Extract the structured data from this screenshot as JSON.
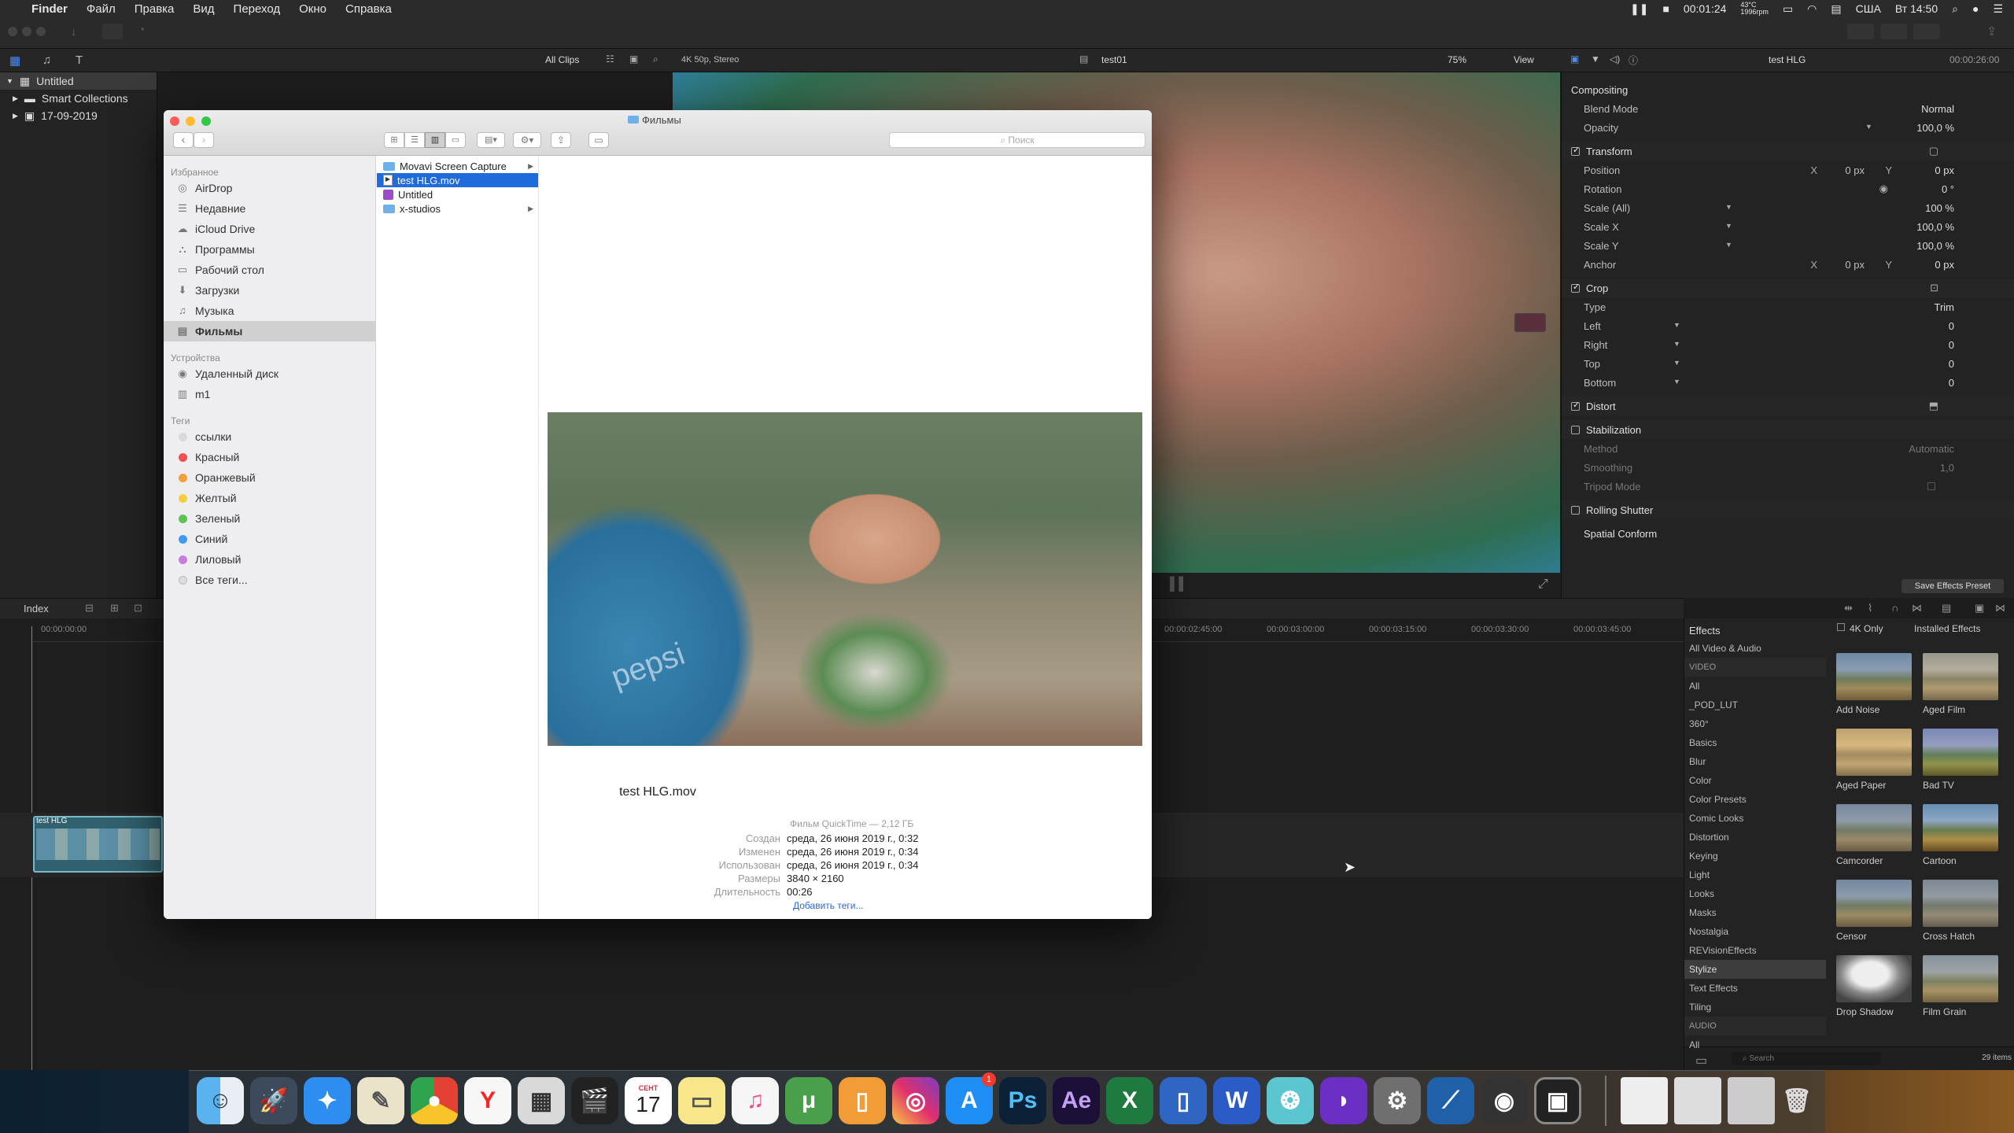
{
  "menubar": {
    "app": "Finder",
    "items": [
      "Файл",
      "Правка",
      "Вид",
      "Переход",
      "Окно",
      "Справка"
    ],
    "timer": "00:01:24",
    "temp": "43°C",
    "rpm": "1996rpm",
    "input_lang": "США",
    "clock": "Вт 14:50"
  },
  "fcp": {
    "library_name": "Untitled",
    "library_items": [
      "Smart Collections",
      "17-09-2019"
    ],
    "browser_filter": "All Clips",
    "format": "4K 50p, Stereo",
    "viewer_title": "test01",
    "zoom": "75%",
    "view_label": "View",
    "inspector_title": "test HLG",
    "inspector_time": "00:00:26:00",
    "index_label": "Index",
    "ruler_ticks": [
      "00:00:00:00",
      "00:00:02:45:00",
      "00:00:03:00:00",
      "00:00:03:15:00",
      "00:00:03:30:00",
      "00:00:03:45:00"
    ],
    "ruler_ticks_display": [
      "00:00:00:00",
      "00:00:02:45:00",
      "00:00:03:00:00",
      "00:00:03:15:00",
      "00:00:03:30:00",
      "00:00:03:45:00"
    ],
    "clip_label": "test HLG",
    "save_preset": "Save Effects Preset"
  },
  "inspector": {
    "compositing": "Compositing",
    "blend_mode_label": "Blend Mode",
    "blend_mode_value": "Normal",
    "opacity_label": "Opacity",
    "opacity_value": "100,0 %",
    "transform": "Transform",
    "position_label": "Position",
    "position_x": "0 px",
    "position_y": "0 px",
    "rotation_label": "Rotation",
    "rotation_value": "0 °",
    "scale_all_label": "Scale (All)",
    "scale_all_value": "100 %",
    "scale_x_label": "Scale X",
    "scale_x_value": "100,0 %",
    "scale_y_label": "Scale Y",
    "scale_y_value": "100,0 %",
    "anchor_label": "Anchor",
    "anchor_x": "0 px",
    "anchor_y": "0 px",
    "crop": "Crop",
    "type_label": "Type",
    "type_value": "Trim",
    "left_label": "Left",
    "right_label": "Right",
    "top_label": "Top",
    "bottom_label": "Bottom",
    "zero": "0",
    "distort": "Distort",
    "stabilization": "Stabilization",
    "method_label": "Method",
    "method_value": "Automatic",
    "smoothing_label": "Smoothing",
    "smoothing_value": "1,0",
    "tripod_label": "Tripod Mode",
    "rolling_shutter": "Rolling Shutter",
    "spatial_conform": "Spatial Conform",
    "x_label": "X",
    "y_label": "Y"
  },
  "effects": {
    "title": "Effects",
    "filter_4k": "4K Only",
    "installed": "Installed Effects",
    "categories": [
      "All Video & Audio",
      "VIDEO",
      "All",
      "_POD_LUT",
      "360°",
      "Basics",
      "Blur",
      "Color",
      "Color Presets",
      "Comic Looks",
      "Distortion",
      "Keying",
      "Light",
      "Looks",
      "Masks",
      "Nostalgia",
      "REVisionEffects",
      "Stylize",
      "Text Effects",
      "Tiling",
      "AUDIO",
      "All"
    ],
    "selected_category": "Stylize",
    "thumbnails": [
      "Add Noise",
      "Aged Film",
      "Aged Paper",
      "Bad TV",
      "Camcorder",
      "Cartoon",
      "Censor",
      "Cross Hatch",
      "Drop Shadow",
      "Film Grain"
    ],
    "search_placeholder": "Search",
    "count": "29 items"
  },
  "finder": {
    "title": "Фильмы",
    "search_placeholder": "Поиск",
    "sidebar": {
      "favorites_header": "Избранное",
      "favorites": [
        "AirDrop",
        "Недавние",
        "iCloud Drive",
        "Программы",
        "Рабочий стол",
        "Загрузки",
        "Музыка",
        "Фильмы"
      ],
      "devices_header": "Устройства",
      "devices": [
        "Удаленный диск",
        "m1"
      ],
      "tags_header": "Теги",
      "tags": [
        {
          "name": "ссылки",
          "color": "#d9d9d9"
        },
        {
          "name": "Красный",
          "color": "#f2524b"
        },
        {
          "name": "Оранжевый",
          "color": "#f5a03a"
        },
        {
          "name": "Желтый",
          "color": "#f6cd3d"
        },
        {
          "name": "Зеленый",
          "color": "#5bc450"
        },
        {
          "name": "Синий",
          "color": "#3e9bf2"
        },
        {
          "name": "Лиловый",
          "color": "#c67ce0"
        }
      ],
      "all_tags": "Все теги..."
    },
    "column": [
      "Movavi Screen Capture",
      "test HLG.mov",
      "Untitled",
      "x-studios"
    ],
    "selected": "test HLG.mov",
    "preview": {
      "filename": "test HLG.mov",
      "kind": "Фильм QuickTime — 2,12 ГБ",
      "rows": [
        {
          "k": "Создан",
          "v": "среда, 26 июня 2019 г., 0:32"
        },
        {
          "k": "Изменен",
          "v": "среда, 26 июня 2019 г., 0:34"
        },
        {
          "k": "Использован",
          "v": "среда, 26 июня 2019 г., 0:34"
        },
        {
          "k": "Размеры",
          "v": "3840 × 2160"
        },
        {
          "k": "Длительность",
          "v": "00:26"
        }
      ],
      "add_tags": "Добавить теги..."
    }
  },
  "dock": {
    "calendar_month": "СЕНТ",
    "calendar_day": "17",
    "badge": "1"
  }
}
